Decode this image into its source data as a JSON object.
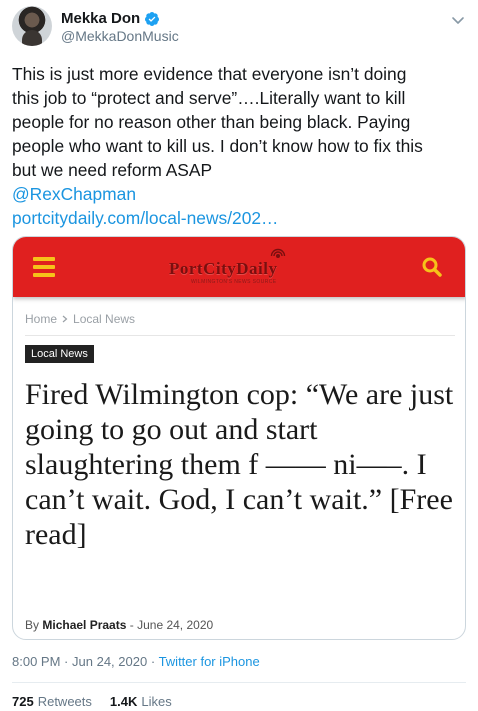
{
  "user": {
    "name": "Mekka Don",
    "handle": "@MekkaDonMusic",
    "verified_icon": "verified-badge-icon",
    "accent": "#1da1f2"
  },
  "tweet": {
    "lines": [
      "This is just more evidence that everyone isn’t doing",
      "this job to “protect and serve”….Literally want to kill",
      "people for no reason other than being black. Paying",
      "people who want to kill us. I don’t know how to fix this",
      "but we need reform ASAP"
    ],
    "mention": "@RexChapman",
    "url": "portcitydaily.com/local-news/202…"
  },
  "card": {
    "site_name": "PortCityDaily",
    "site_tagline": "WILMINGTON'S NEWS SOURCE",
    "bar_color": "#e0201f",
    "breadcrumb": [
      "Home",
      "Local News"
    ],
    "category": "Local News",
    "headline": "Fired Wilmington cop: “We are just going to go out and start slaughtering them f —— ni—–. I can’t wait. God, I can’t wait.” [Free read]",
    "byline_prefix": "By",
    "author": "Michael Praats",
    "byline_sep": "-",
    "date": "June 24, 2020"
  },
  "meta": {
    "time": "8:00 PM",
    "dot1": "·",
    "date": "Jun 24, 2020",
    "dot2": "·",
    "source": "Twitter for iPhone"
  },
  "stats": {
    "retweets_count": "725",
    "retweets_label": "Retweets",
    "likes_count": "1.4K",
    "likes_label": "Likes"
  }
}
